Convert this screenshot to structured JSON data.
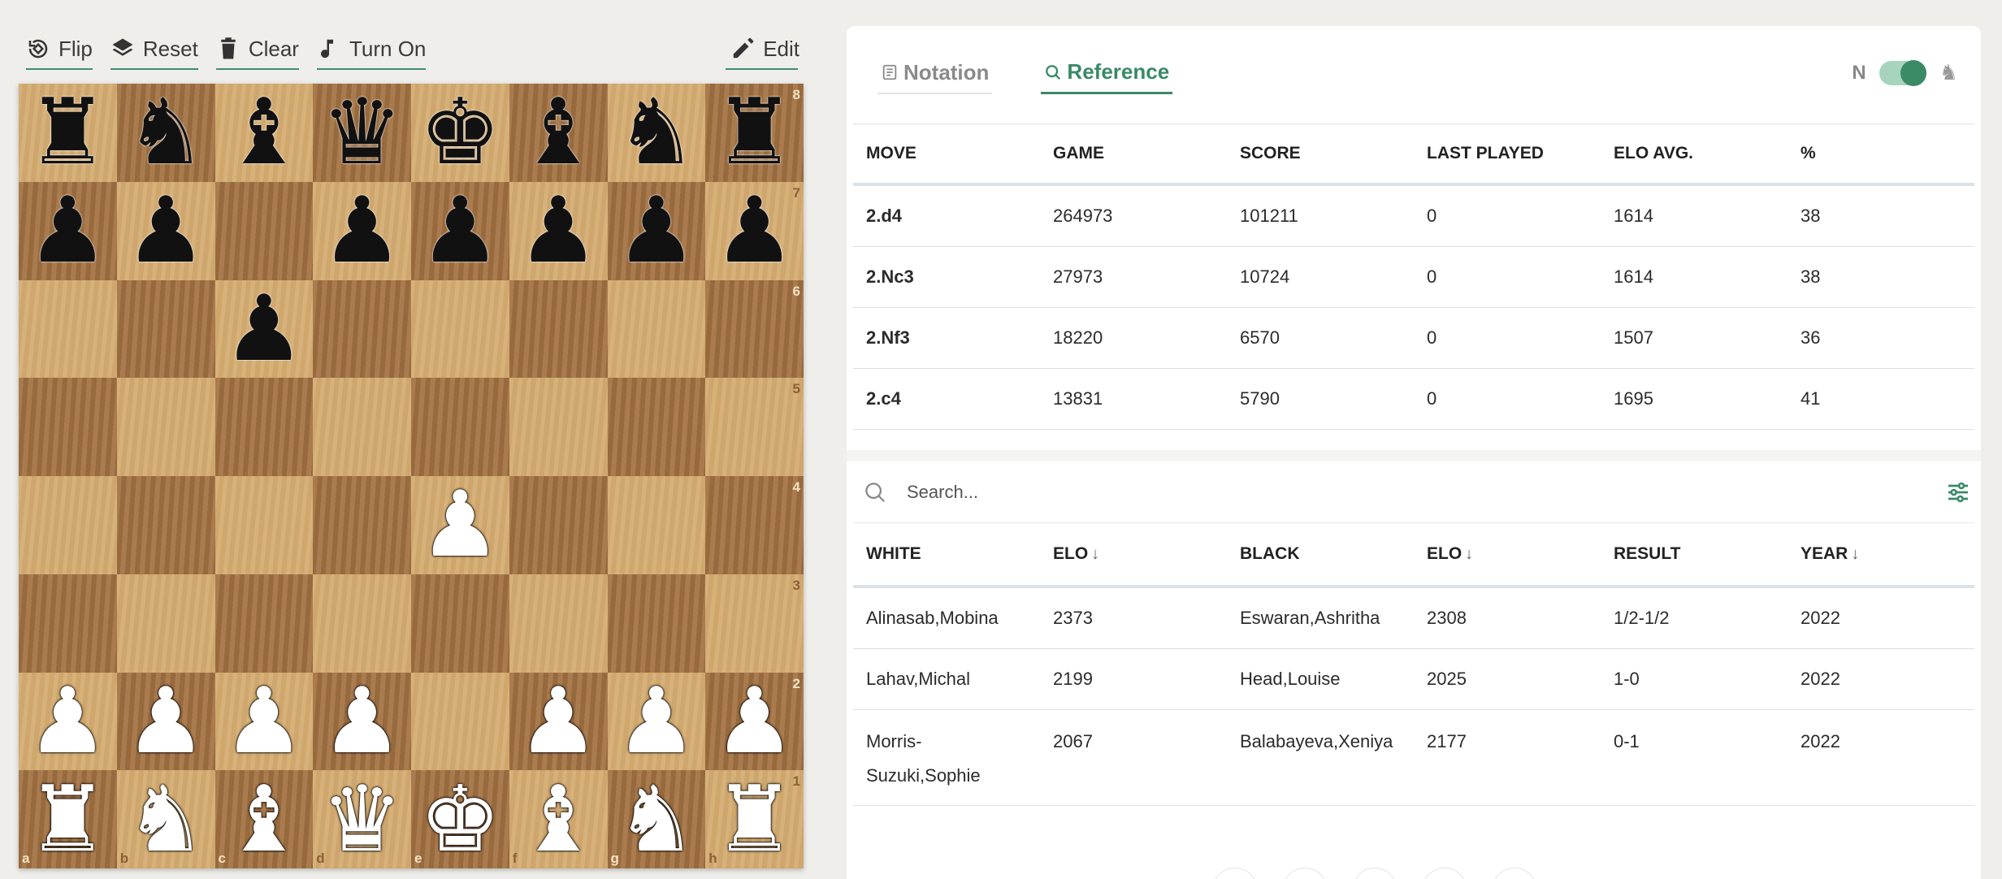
{
  "toolbar": {
    "flip": "Flip",
    "reset": "Reset",
    "clear": "Clear",
    "turn_on": "Turn On",
    "edit": "Edit"
  },
  "board": {
    "ranks": [
      "8",
      "7",
      "6",
      "5",
      "4",
      "3",
      "2",
      "1"
    ],
    "files": [
      "a",
      "b",
      "c",
      "d",
      "e",
      "f",
      "g",
      "h"
    ],
    "position": [
      [
        "r",
        "n",
        "b",
        "q",
        "k",
        "b",
        "n",
        "r"
      ],
      [
        "p",
        "p",
        "",
        "p",
        "p",
        "p",
        "p",
        "p"
      ],
      [
        "",
        "",
        "p",
        "",
        "",
        "",
        "",
        ""
      ],
      [
        "",
        "",
        "",
        "",
        "",
        "",
        "",
        ""
      ],
      [
        "",
        "",
        "",
        "",
        "P",
        "",
        "",
        ""
      ],
      [
        "",
        "",
        "",
        "",
        "",
        "",
        "",
        ""
      ],
      [
        "P",
        "P",
        "P",
        "P",
        "",
        "P",
        "P",
        "P"
      ],
      [
        "R",
        "N",
        "B",
        "Q",
        "K",
        "B",
        "N",
        "R"
      ]
    ]
  },
  "tabs": {
    "notation": "Notation",
    "reference": "Reference"
  },
  "toggle": {
    "label": "N",
    "icon": "knight-icon"
  },
  "reference": {
    "columns": [
      "MOVE",
      "GAME",
      "SCORE",
      "LAST PLAYED",
      "ELO AVG.",
      "%"
    ],
    "rows": [
      [
        "2.d4",
        "264973",
        "101211",
        "0",
        "1614",
        "38"
      ],
      [
        "2.Nc3",
        "27973",
        "10724",
        "0",
        "1614",
        "38"
      ],
      [
        "2.Nf3",
        "18220",
        "6570",
        "0",
        "1507",
        "36"
      ],
      [
        "2.c4",
        "13831",
        "5790",
        "0",
        "1695",
        "41"
      ]
    ]
  },
  "search": {
    "placeholder": "Search..."
  },
  "games": {
    "columns": [
      "WHITE",
      "ELO",
      "BLACK",
      "ELO",
      "RESULT",
      "YEAR"
    ],
    "rows": [
      [
        "Alinasab,Mobina",
        "2373",
        "Eswaran,Ashritha",
        "2308",
        "1/2-1/2",
        "2022"
      ],
      [
        "Lahav,Michal",
        "2199",
        "Head,Louise",
        "2025",
        "1-0",
        "2022"
      ],
      [
        "Morris-Suzuki,Sophie",
        "2067",
        "Balabayeva,Xeniya",
        "2177",
        "0-1",
        "2022"
      ]
    ]
  },
  "colors": {
    "accent": "#3a8a66",
    "light_square": "#d4ac72",
    "dark_square": "#a47445"
  }
}
